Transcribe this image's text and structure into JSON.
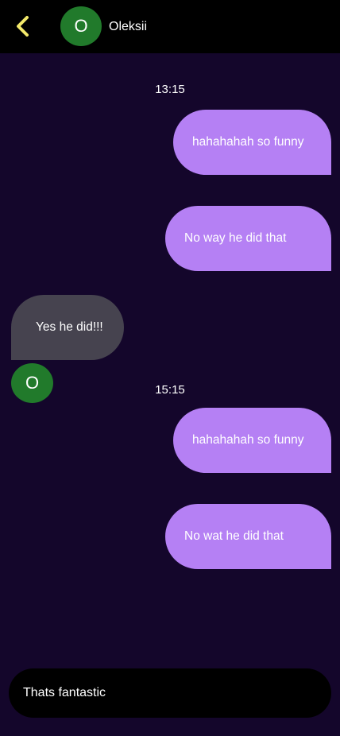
{
  "header": {
    "back_icon": "chevron-left-icon",
    "avatar_initial": "O",
    "contact_name": "Oleksii",
    "accent_color": "#f3e96b",
    "avatar_color": "#217a2b"
  },
  "messages": {
    "time_1": "13:15",
    "msg_1": "hahahahah so funny",
    "msg_2": "No way he did that",
    "msg_3": "Yes he did!!!",
    "msg_3_avatar_initial": "O",
    "time_2": "15:15",
    "msg_4": "hahahahah so funny",
    "msg_5": "No wat he did that"
  },
  "colors": {
    "background": "#14062b",
    "outgoing_bubble": "#b580f4",
    "incoming_bubble": "#46434f"
  },
  "composer": {
    "value": "Thats fantastic"
  }
}
